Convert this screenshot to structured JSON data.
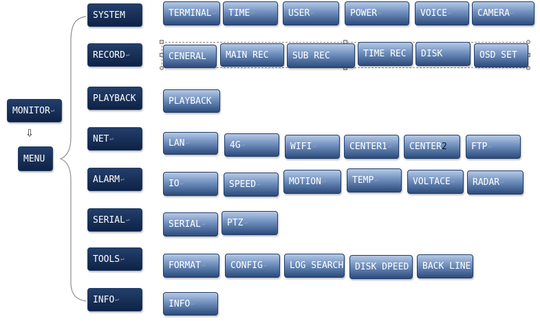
{
  "monitor_label": "MONITOR",
  "menu_label": "MENU",
  "para_mark": "↵",
  "arrow_glyph": "⇩",
  "colors": {
    "menu_top": "#233f6a",
    "menu_bottom": "#0e2246",
    "sub_top": "#b5c9e6",
    "sub_bottom": "#2c4b7c"
  },
  "categories": [
    {
      "label": "SYSTEM",
      "items": [
        "TERMINAL",
        "TIME",
        "USER",
        "POWER",
        "VOICE",
        "CAMERA"
      ]
    },
    {
      "label": "RECORD",
      "items": [
        "CENERAL",
        "MAIN REC",
        "SUB REC",
        "TIME REC",
        "DISK",
        "OSD SET"
      ]
    },
    {
      "label": "PLAYBACK",
      "items": [
        "PLAYBACK"
      ]
    },
    {
      "label": "NET",
      "items": [
        "LAN",
        "4G",
        "WIFI",
        "CENTER1",
        "CENTER",
        "FTP"
      ],
      "center2_suffix": "2"
    },
    {
      "label": "ALARM",
      "items": [
        "IO",
        "SPEED",
        "MOTION",
        "TEMP",
        "VOLTACE",
        "RADAR"
      ]
    },
    {
      "label": "SERIAL",
      "items": [
        "SERIAL",
        "PTZ"
      ]
    },
    {
      "label": "TOOLS",
      "items": [
        "FORMAT",
        "CONFIG",
        "LOG SEARCH",
        "DISK DPEED",
        "BACK LINE"
      ]
    },
    {
      "label": "INFO",
      "items": [
        "INFO"
      ]
    }
  ]
}
